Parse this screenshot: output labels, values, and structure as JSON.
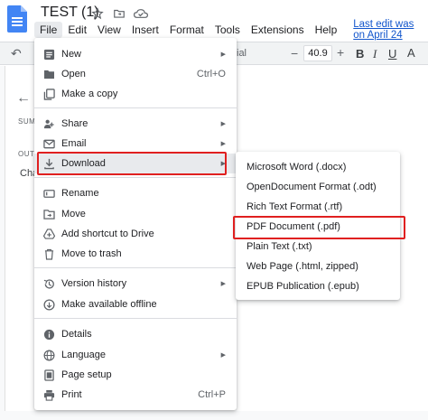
{
  "doc": {
    "title": "TEST (1)"
  },
  "menubar": {
    "items": [
      "File",
      "Edit",
      "View",
      "Insert",
      "Format",
      "Tools",
      "Extensions",
      "Help"
    ],
    "last_edit": "Last edit was on April 24"
  },
  "toolbar": {
    "font_partial": "ial",
    "font_size": "40.9",
    "minus": "−",
    "plus": "+",
    "bold": "B",
    "italic": "I",
    "underline": "U",
    "text_color": "A"
  },
  "outline": {
    "summary_partial": "SUM",
    "outline_partial": "OUTL",
    "item_partial": "Cha"
  },
  "file_menu": {
    "items": [
      {
        "label": "New",
        "icon": "new-doc-icon",
        "arrow": true
      },
      {
        "label": "Open",
        "icon": "folder-icon",
        "shortcut": "Ctrl+O"
      },
      {
        "label": "Make a copy",
        "icon": "copy-icon"
      },
      {
        "label": "Share",
        "icon": "share-icon",
        "arrow": true
      },
      {
        "label": "Email",
        "icon": "email-icon",
        "arrow": true
      },
      {
        "label": "Download",
        "icon": "download-icon",
        "arrow": true
      },
      {
        "label": "Rename",
        "icon": "rename-icon"
      },
      {
        "label": "Move",
        "icon": "move-icon"
      },
      {
        "label": "Add shortcut to Drive",
        "icon": "drive-shortcut-icon"
      },
      {
        "label": "Move to trash",
        "icon": "trash-icon"
      },
      {
        "label": "Version history",
        "icon": "history-icon",
        "arrow": true
      },
      {
        "label": "Make available offline",
        "icon": "offline-icon"
      },
      {
        "label": "Details",
        "icon": "info-icon"
      },
      {
        "label": "Language",
        "icon": "globe-icon",
        "arrow": true
      },
      {
        "label": "Page setup",
        "icon": "page-setup-icon"
      },
      {
        "label": "Print",
        "icon": "print-icon",
        "shortcut": "Ctrl+P"
      }
    ]
  },
  "download_menu": {
    "items": [
      "Microsoft Word (.docx)",
      "OpenDocument Format (.odt)",
      "Rich Text Format (.rtf)",
      "PDF Document (.pdf)",
      "Plain Text (.txt)",
      "Web Page (.html, zipped)",
      "EPUB Publication (.epub)"
    ]
  },
  "colors": {
    "highlight_box": "#e02020",
    "link": "#1155cc",
    "docs_blue": "#4285f4"
  }
}
